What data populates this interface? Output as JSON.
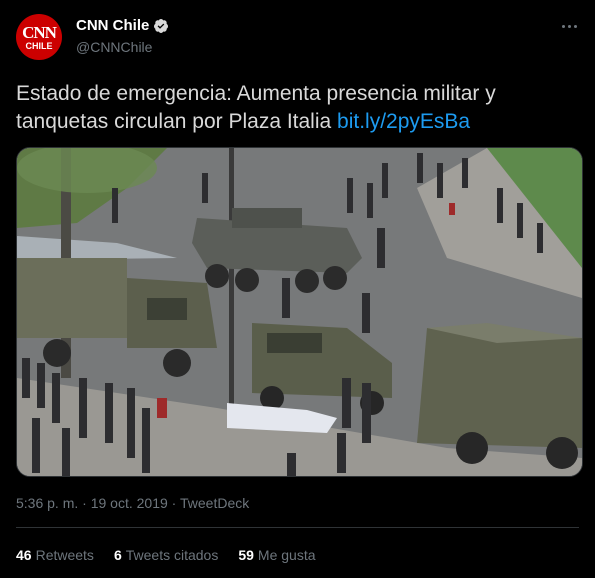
{
  "account": {
    "display_name": "CNN Chile",
    "handle": "@CNNChile",
    "avatar_top": "CNN",
    "avatar_bottom": "CHILE",
    "verified_icon": "verified-badge-icon"
  },
  "tweet": {
    "text": "Estado de emergencia: Aumenta presencia militar y tanquetas circulan por Plaza Italia ",
    "link": "bit.ly/2pyEsBa"
  },
  "meta": {
    "time": "5:36 p. m.",
    "separator": " · ",
    "date": "19 oct. 2019",
    "source": "TweetDeck"
  },
  "stats": {
    "retweets_count": "46",
    "retweets_label": "Retweets",
    "quotes_count": "6",
    "quotes_label": "Tweets citados",
    "likes_count": "59",
    "likes_label": "Me gusta"
  },
  "colors": {
    "background": "#000000",
    "link": "#1d9bf0",
    "secondary_text": "#6e767d",
    "brand_red": "#cc0000"
  }
}
